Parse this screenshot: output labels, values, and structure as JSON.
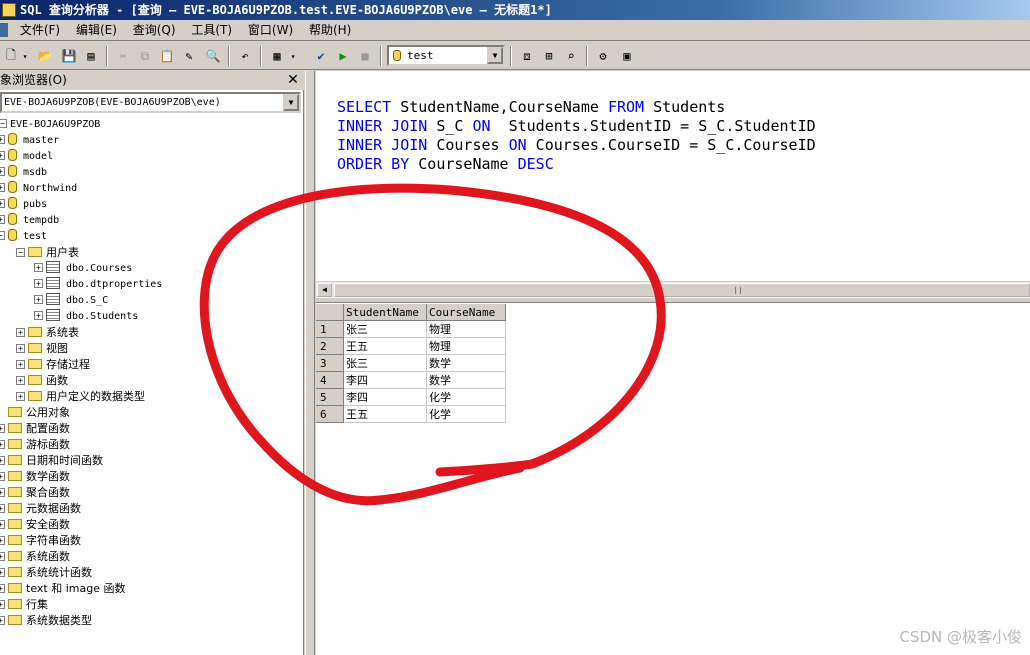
{
  "title_bar": {
    "text": "SQL 查询分析器 - [查询 — EVE-BOJA6U9PZOB.test.EVE-BOJA6U9PZOB\\eve — 无标题1*]"
  },
  "menu": [
    "文件(F)",
    "编辑(E)",
    "查询(Q)",
    "工具(T)",
    "窗口(W)",
    "帮助(H)"
  ],
  "toolbar": {
    "database": "test"
  },
  "object_browser": {
    "title": "对象浏览器(O)",
    "server_select": "EVE-BOJA6U9PZOB(EVE-BOJA6U9PZOB\\eve)",
    "server": "EVE-BOJA6U9PZOB",
    "databases": [
      "master",
      "model",
      "msdb",
      "Northwind",
      "pubs",
      "tempdb",
      "test"
    ],
    "user_tables_folder": "用户表",
    "tables": [
      "dbo.Courses",
      "dbo.dtproperties",
      "dbo.S_C",
      "dbo.Students"
    ],
    "test_folders": [
      "系统表",
      "视图",
      "存储过程",
      "函数",
      "用户定义的数据类型"
    ],
    "common_objects": "公用对象",
    "common_folders": [
      "配置函数",
      "游标函数",
      "日期和时间函数",
      "数学函数",
      "聚合函数",
      "元数据函数",
      "安全函数",
      "字符串函数",
      "系统函数",
      "系统统计函数",
      "text 和 image 函数",
      "行集",
      "系统数据类型"
    ]
  },
  "sql_lines": [
    [
      "SELECT",
      " StudentName,CourseName ",
      "FROM",
      " Students"
    ],
    [
      "INNER JOIN",
      " S_C ",
      "ON",
      "  Students.StudentID = S_C.StudentID"
    ],
    [
      "INNER JOIN",
      " Courses ",
      "ON",
      " Courses.CourseID = S_C.CourseID"
    ],
    [
      "ORDER BY",
      " CourseName ",
      "DESC",
      ""
    ]
  ],
  "results": {
    "columns": [
      "StudentName",
      "CourseName"
    ],
    "rows": [
      [
        "1",
        "张三",
        "物理"
      ],
      [
        "2",
        "王五",
        "物理"
      ],
      [
        "3",
        "张三",
        "数学"
      ],
      [
        "4",
        "李四",
        "数学"
      ],
      [
        "5",
        "李四",
        "化学"
      ],
      [
        "6",
        "王五",
        "化学"
      ]
    ]
  },
  "watermark": "CSDN @极客小俊",
  "colors": {
    "keyword": "#0000ff",
    "annotation": "#e0161f"
  }
}
